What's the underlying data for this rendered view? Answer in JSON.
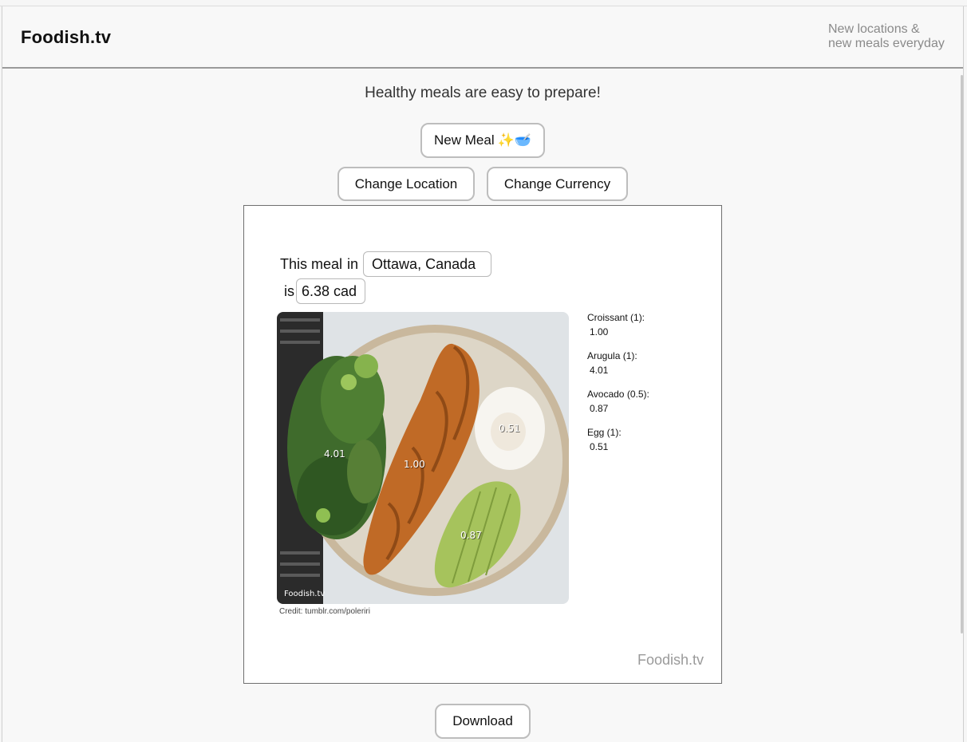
{
  "header": {
    "brand": "Foodish.tv",
    "tagline_line1": "New locations &",
    "tagline_line2": "new meals everyday"
  },
  "subtitle": "Healthy meals are easy to prepare!",
  "buttons": {
    "new_meal": "New Meal",
    "new_meal_emoji": "✨🥣",
    "change_location": "Change Location",
    "change_currency": "Change Currency",
    "download": "Download"
  },
  "card": {
    "this_meal": "This meal",
    "in": "in",
    "location": "Ottawa, Canada",
    "is": "is",
    "price": "6.38 cad",
    "photo_watermark": "Foodish.tv",
    "credit": "Credit: tumblr.com/poleriri",
    "watermark": "Foodish.tv"
  },
  "photo_labels": {
    "croissant": "1.00",
    "arugula": "4.01",
    "avocado": "0.87",
    "egg": "0.51"
  },
  "breakdown": [
    {
      "name": "Croissant (1):",
      "value": "1.00"
    },
    {
      "name": "Arugula (1):",
      "value": "4.01"
    },
    {
      "name": "Avocado (0.5):",
      "value": "0.87"
    },
    {
      "name": "Egg (1):",
      "value": "0.51"
    }
  ],
  "colors": {
    "border": "#bdbdbd",
    "muted_text": "#8a8a8a",
    "plate": "#c9b89d",
    "croissant": "#c06a26",
    "arugula": "#3f6b2c",
    "avocado": "#a6c35c",
    "egg_white": "#f7f5f0"
  }
}
